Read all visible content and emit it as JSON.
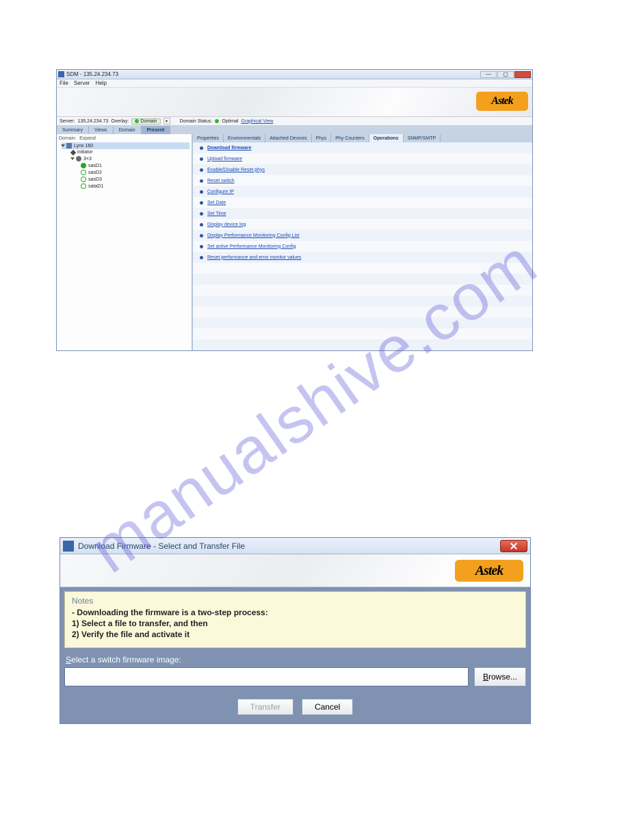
{
  "watermark_text": "manualshive.com",
  "app1": {
    "window_title": "SDM - 135.24.234.73",
    "menu": {
      "file": "File",
      "server": "Server",
      "help": "Help"
    },
    "logo_text": "Astek",
    "status": {
      "server_label": "Server:",
      "server_value": "135.24.234.73",
      "overlay_label": "Overlay:",
      "overlay_value": "Domain",
      "domain_status_label": "Domain Status:",
      "domain_status_value": "Optimal",
      "graphical_link": "Graphical View"
    },
    "left_tabs": {
      "summary": "Summary",
      "views": "Views",
      "domain": "Domain",
      "present": "Present"
    },
    "tree": {
      "head_domain": "Domain",
      "head_expand": "Expand",
      "root": "Lynx 160",
      "initiator": "initiator",
      "sw": "3×3",
      "d1": "sasD1",
      "d2": "sasD2",
      "d3": "sasD3",
      "d4": "sataD1"
    },
    "right_tabs": {
      "properties": "Properties",
      "environmentals": "Environmentals",
      "attached": "Attached Devices",
      "phys": "Phys",
      "phycounters": "Phy Counters",
      "operations": "Operations",
      "snmp": "SNMP/SMTP"
    },
    "ops": [
      "Download firmware",
      "Upload firmware",
      "Enable/Disable Reset phys",
      "Reset switch",
      "Configure IP",
      "Set Date",
      "Set Time",
      "Display device log",
      "Display Performance Monitoring Config List",
      "Set active Performance Monitoring Config",
      "Reset performance and error monitor values"
    ]
  },
  "dlg": {
    "title": "Download Firmware - Select and Transfer File",
    "logo_text": "Astek",
    "notes_legend": "Notes",
    "notes_line1": "- Downloading the firmware is a two-step process:",
    "notes_line2": "1) Select a file to transfer, and then",
    "notes_line3": "2) Verify the file and activate it",
    "select_label_s": "S",
    "select_label_rest": "elect a switch firmware image:",
    "browse": "Browse...",
    "transfer": "Transfer",
    "cancel": "Cancel"
  }
}
